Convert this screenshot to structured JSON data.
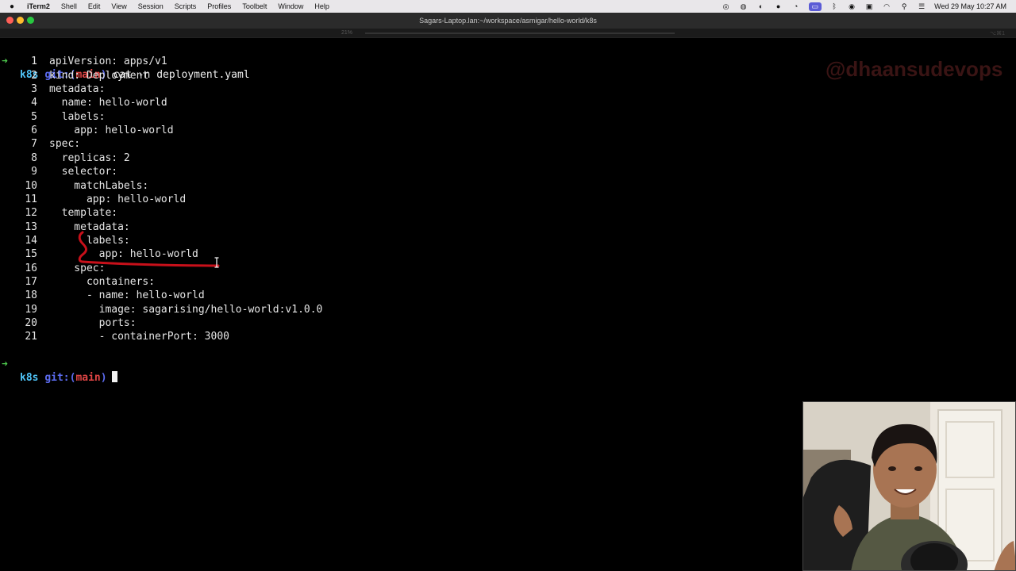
{
  "menubar": {
    "app_name": "iTerm2",
    "menus": [
      "Shell",
      "Edit",
      "View",
      "Session",
      "Scripts",
      "Profiles",
      "Toolbelt",
      "Window",
      "Help"
    ],
    "datetime": "Wed 29 May  10:27 AM"
  },
  "window": {
    "title": "Sagars-Laptop.lan:~/workspace/asmigar/hello-world/k8s",
    "tab_badge": "21%",
    "shortcut": "⌥⌘1"
  },
  "terminal": {
    "prompt_dir": "k8s",
    "prompt_git": "git:(",
    "prompt_branch": "main",
    "prompt_close": ")",
    "command": "cat -n deployment.yaml",
    "lines": [
      {
        "n": "1",
        "text": "apiVersion: apps/v1"
      },
      {
        "n": "2",
        "text": "kind: Deployment"
      },
      {
        "n": "3",
        "text": "metadata:"
      },
      {
        "n": "4",
        "text": "  name: hello-world"
      },
      {
        "n": "5",
        "text": "  labels:"
      },
      {
        "n": "6",
        "text": "    app: hello-world"
      },
      {
        "n": "7",
        "text": "spec:"
      },
      {
        "n": "8",
        "text": "  replicas: 2"
      },
      {
        "n": "9",
        "text": "  selector:"
      },
      {
        "n": "10",
        "text": "    matchLabels:"
      },
      {
        "n": "11",
        "text": "      app: hello-world"
      },
      {
        "n": "12",
        "text": "  template:"
      },
      {
        "n": "13",
        "text": "    metadata:"
      },
      {
        "n": "14",
        "text": "      labels:"
      },
      {
        "n": "15",
        "text": "        app: hello-world"
      },
      {
        "n": "16",
        "text": "    spec:"
      },
      {
        "n": "17",
        "text": "      containers:"
      },
      {
        "n": "18",
        "text": "      - name: hello-world"
      },
      {
        "n": "19",
        "text": "        image: sagarising/hello-world:v1.0.0"
      },
      {
        "n": "20",
        "text": "        ports:"
      },
      {
        "n": "21",
        "text": "        - containerPort: 3000"
      }
    ]
  },
  "watermark": "@dhaansudevops",
  "colors": {
    "prompt_arrow": "#4ec94e",
    "prompt_dir": "#4fc3f7",
    "prompt_git": "#5c6cf0",
    "prompt_branch": "#e04545",
    "annotation": "#c8101a"
  }
}
